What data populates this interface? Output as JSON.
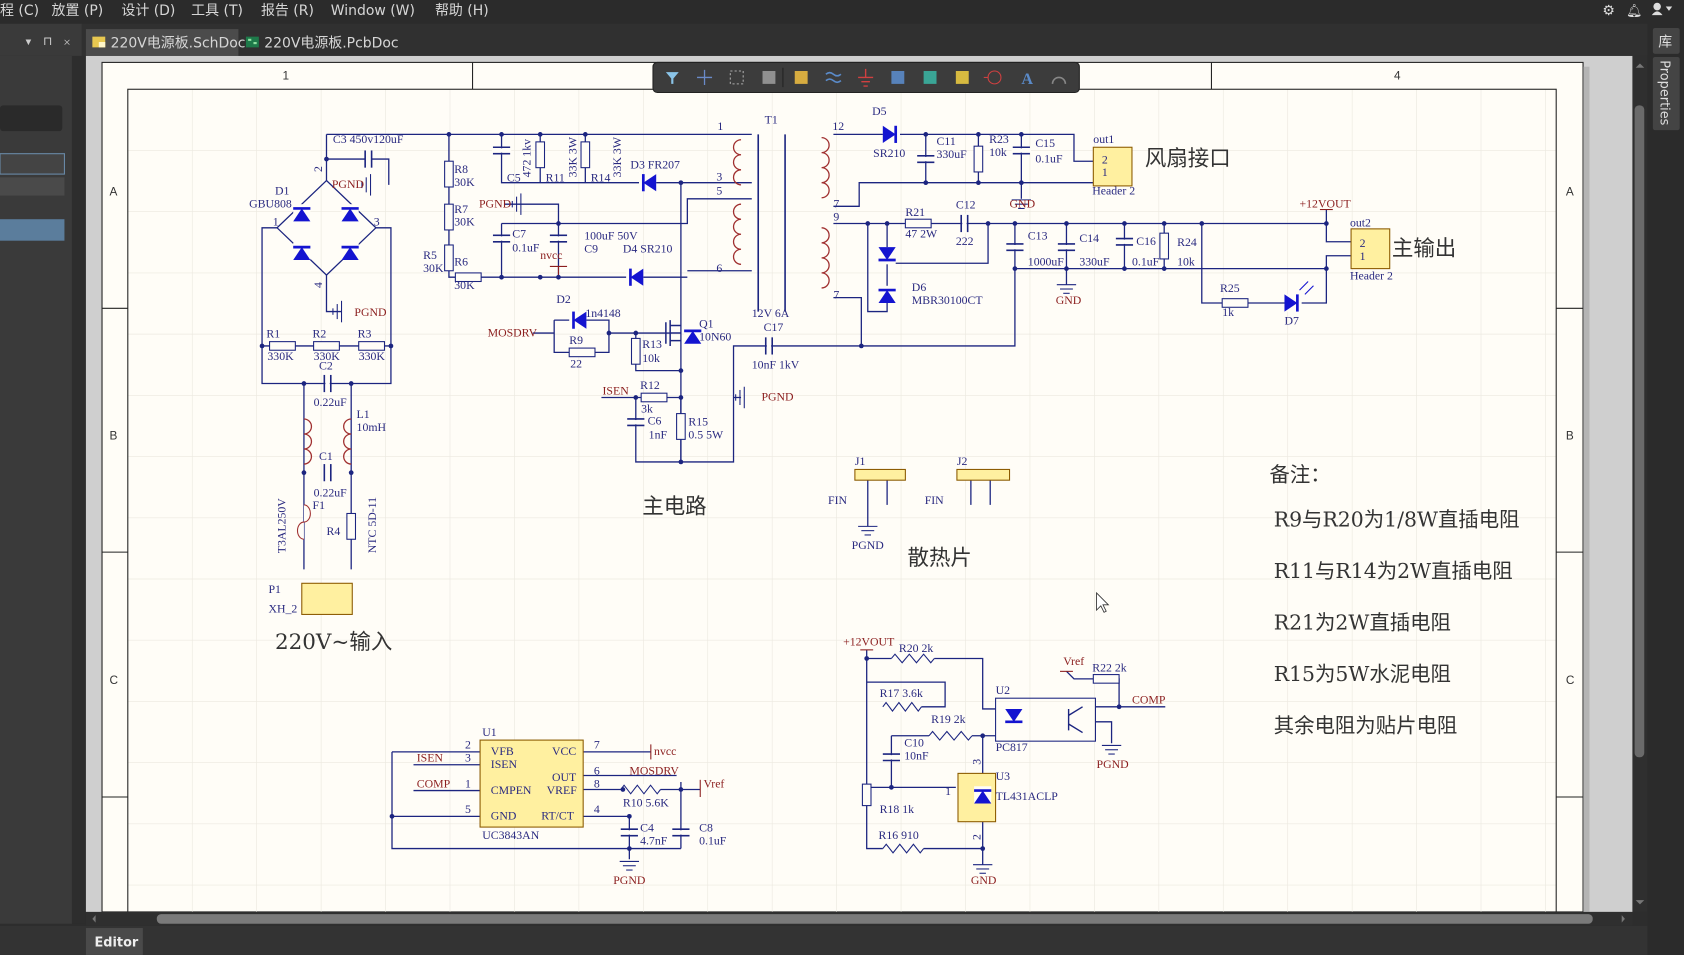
{
  "menu": {
    "items": [
      "程 (C)",
      "放置 (P)",
      "设计 (D)",
      "工具 (T)",
      "报告 (R)",
      "Window (W)",
      "帮助 (H)"
    ],
    "right_icons": [
      "gear-icon",
      "bell-icon",
      "user-icon"
    ]
  },
  "tabs": [
    {
      "label": "220V电源板.SchDoc",
      "active": true,
      "icon": "schematic-doc-icon"
    },
    {
      "label": "220V电源板.PcbDoc",
      "active": false,
      "icon": "pcb-doc-icon"
    }
  ],
  "left_panel": {
    "controls": [
      "▼",
      "⊓",
      "×"
    ]
  },
  "right_panel": {
    "library_label": "库",
    "properties_label": "Properties"
  },
  "bottom": {
    "editor_tab": "Editor"
  },
  "toolbar": {
    "tools": [
      "filter-icon",
      "crosshair-icon",
      "select-rect-icon",
      "align-icon",
      "component-icon",
      "wire-icon",
      "ground-power-icon",
      "bus-icon",
      "sheet-symbol-icon",
      "net-label-icon",
      "port-icon",
      "text-icon",
      "arc-icon"
    ]
  },
  "frame": {
    "col1": "1",
    "col4": "4",
    "rowA": "A",
    "rowB": "B",
    "rowC": "C"
  },
  "colors": {
    "wire": "#1c2580",
    "component_text": "#2a2a80",
    "net_text": "#8b1e1e",
    "diode": "#1414d0",
    "coil": "#a03030",
    "header_fill": "#fff0a0",
    "sheet": "#fffdf7"
  },
  "schematic": {
    "titles": {
      "input": "220V~输入",
      "main": "主电路",
      "fan": "风扇接口",
      "out": "主输出",
      "heatsink": "散热片"
    },
    "notes": {
      "title": "备注：",
      "lines": [
        "R9与R20为1/8W直插电阻",
        "R11与R14为2W直插电阻",
        "R21为2W直插电阻",
        "R15为5W水泥电阻",
        "其余电阻为贴片电阻"
      ]
    },
    "l": {
      "c3": "C3  450v120uF",
      "d1": "D1",
      "gbu": "GBU808",
      "pgnd1": "PGND",
      "p1a": "1",
      "p3a": "3",
      "p2a": "2",
      "p4a": "4",
      "pgnd2": "PGND",
      "r1": "R1",
      "r1v": "330K",
      "r2": "R2",
      "r2v": "330K",
      "r3": "R3",
      "r3v": "330K",
      "c2": "C2",
      "c2v": "0.22uF",
      "l1": "L1",
      "l1v": "10mH",
      "c1": "C1",
      "c1v": "0.22uF",
      "f1": "F1",
      "f1v": "T3AL250V",
      "r4": "R4",
      "r4v": "NTC 5D-11",
      "p1": "P1",
      "p1v": "XH_2",
      "r8": "R8",
      "r8v": "30K",
      "r7": "R7",
      "r7v": "30K",
      "r5": "R5",
      "r5v": "30K",
      "r6": "R6",
      "r6v": "30K",
      "c5": "C5",
      "c5v": "472 1kv",
      "r11": "R11",
      "r11v": "33K 3W",
      "r14": "R14",
      "r14v": "33K 3W",
      "d3": "D3  FR207",
      "t1": "T1",
      "t1p1": "1",
      "t1p3": "3",
      "t1p5": "5",
      "t1p6": "6",
      "pgnd3": "PGND",
      "c7": "C7",
      "c7v": "0.1uF",
      "c9v": "100uF 50V",
      "c9": "C9",
      "nvcc1": "nvcc",
      "d4": "D4  SR210",
      "d2": "D2",
      "d2v": "1n4148",
      "mosdrv1": "MOSDRV",
      "r9": "R9",
      "r9v": "22",
      "r13": "R13",
      "r13v": "10k",
      "q1": "Q1",
      "q1v": "10N60",
      "t1v": "12V 6A",
      "c17": "C17",
      "c17v": "10nF 1kV",
      "isen1": "ISEN",
      "r12": "R12",
      "r12v": "3k",
      "c6": "C6",
      "c6v": "1nF",
      "r15": "R15",
      "r15v": "0.5 5W",
      "pgnd4": "PGND",
      "p12": "12",
      "d5": "D5",
      "d5v": "SR210",
      "c11": "C11",
      "c11v": "330uF",
      "r23": "R23",
      "r23v": "10k",
      "c15": "C15",
      "c15v": "0.1uF",
      "gnd1": "GND",
      "out1": "out1",
      "h1p2": "2",
      "h1p1": "1",
      "h1": "Header 2",
      "p7a": "7",
      "p9": "9",
      "r21": "R21",
      "r21v": "47 2W",
      "c12": "C12",
      "c12v": "222",
      "c13": "C13",
      "c13v": "1000uF",
      "c14": "C14",
      "c14v": "330uF",
      "c16": "C16",
      "c16v": "0.1uF",
      "r24": "R24",
      "r24v": "10k",
      "v12a": "+12VOUT",
      "out2": "out2",
      "h2p2": "2",
      "h2p1": "1",
      "h2": "Header 2",
      "d6": "D6",
      "d6v": "MBR30100CT",
      "p7b": "7",
      "gnd2": "GND",
      "r25": "R25",
      "r25v": "1k",
      "d7": "D7",
      "j1": "J1",
      "fin1": "FIN",
      "pgnd5": "PGND",
      "j2": "J2",
      "fin2": "FIN",
      "u1": "U1",
      "vfb": "VFB",
      "isenp": "ISEN",
      "cmpen": "CMPEN",
      "gndp": "GND",
      "vcc": "VCC",
      "outp": "OUT",
      "vref": "VREF",
      "rtct": "RT/CT",
      "uc": "UC3843AN",
      "u1p2": "2",
      "u1p3": "3",
      "u1p1": "1",
      "u1p5": "5",
      "u1p7": "7",
      "u1p6": "6",
      "u1p8": "8",
      "u1p4": "4",
      "isen2": "ISEN",
      "comp1": "COMP",
      "nvcc2": "nvcc",
      "mosdrv2": "MOSDRV",
      "vref1": "Vref",
      "r10": "R10  5.6K",
      "c4": "C4",
      "c4v": "4.7nF",
      "c8": "C8",
      "c8v": "0.1uF",
      "pgnd6": "PGND",
      "v12b": "+12VOUT",
      "r20": "R20  2k",
      "r17": "R17  3.6k",
      "r19": "R19  2k",
      "c10": "C10",
      "c10v": "10nF",
      "u2": "U2",
      "pc817": "PC817",
      "vref2": "Vref",
      "r22": "R22  2k",
      "comp2": "COMP",
      "pgnd7": "PGND",
      "u3": "U3",
      "tl431": "TL431ACLP",
      "u3p1": "1",
      "u3p3": "3",
      "u3p2": "2",
      "r18": "R18  1k",
      "r16": "R16  910",
      "gnd3": "GND"
    }
  }
}
